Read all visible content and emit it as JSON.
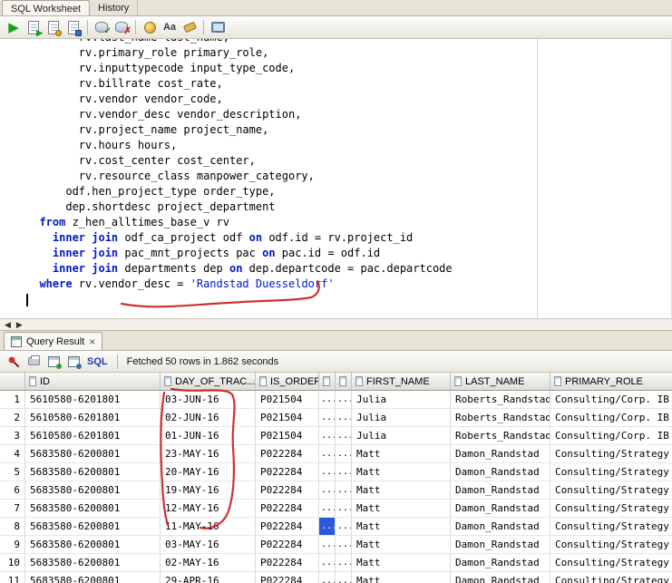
{
  "tabs": {
    "worksheet": "SQL Worksheet",
    "history": "History"
  },
  "icons": {
    "run_glyph": "▶",
    "scroll_left": "◀",
    "scroll_right": "▶",
    "close": "×",
    "commit_check": "✓",
    "rollback_x": "✗",
    "case_toggle": "Aa"
  },
  "worksheet_toolbar_icons": [
    "run-statement-icon",
    "run-script-icon",
    "autotrace-icon",
    "explain-plan-icon",
    "commit-icon",
    "rollback-icon",
    "sql-history-icon",
    "case-toggle-icon",
    "eraser-icon",
    "monitor-icon"
  ],
  "result_toolbar_icons": [
    "pin-icon",
    "printer-icon",
    "refresh-grid-icon",
    "fetch-grid-icon"
  ],
  "editor": {
    "lines": [
      [
        [
          "        rv.last_name last_name,",
          "p"
        ]
      ],
      [
        [
          "        rv.primary_role primary_role,",
          "p"
        ]
      ],
      [
        [
          "        rv.inputtypecode input_type_code,",
          "p"
        ]
      ],
      [
        [
          "        rv.billrate cost_rate,",
          "p"
        ]
      ],
      [
        [
          "        rv.vendor vendor_code,",
          "p"
        ]
      ],
      [
        [
          "        rv.vendor_desc vendor_description,",
          "p"
        ]
      ],
      [
        [
          "        rv.project_name project_name,",
          "p"
        ]
      ],
      [
        [
          "        rv.hours hours,",
          "p"
        ]
      ],
      [
        [
          "        rv.cost_center cost_center,",
          "p"
        ]
      ],
      [
        [
          "        rv.resource_class manpower_category,",
          "p"
        ]
      ],
      [
        [
          "      odf.hen_project_type order_type,",
          "p"
        ]
      ],
      [
        [
          "      dep.shortdesc project_department",
          "p"
        ]
      ],
      [
        [
          "  ",
          "p"
        ],
        [
          "from",
          "k"
        ],
        [
          " z_hen_alltimes_base_v rv",
          "p"
        ]
      ],
      [
        [
          "    ",
          "p"
        ],
        [
          "inner join",
          "k"
        ],
        [
          " odf_ca_project odf ",
          "p"
        ],
        [
          "on",
          "k"
        ],
        [
          " odf.id = rv.project_id",
          "p"
        ]
      ],
      [
        [
          "    ",
          "p"
        ],
        [
          "inner join",
          "k"
        ],
        [
          " pac_mnt_projects pac ",
          "p"
        ],
        [
          "on",
          "k"
        ],
        [
          " pac.id = odf.id",
          "p"
        ]
      ],
      [
        [
          "    ",
          "p"
        ],
        [
          "inner join",
          "k"
        ],
        [
          " departments dep ",
          "p"
        ],
        [
          "on",
          "k"
        ],
        [
          " dep.departcode = pac.departcode",
          "p"
        ]
      ],
      [
        [
          "  ",
          "p"
        ],
        [
          "where",
          "k"
        ],
        [
          " rv.vendor_desc = ",
          "p"
        ],
        [
          "'Randstad Duesseldorf'",
          "s"
        ]
      ]
    ]
  },
  "result_panel": {
    "tab_label": "Query Result",
    "sql_label": "SQL",
    "status": "Fetched 50 rows in 1.862 seconds"
  },
  "grid": {
    "columns": [
      {
        "label": ""
      },
      {
        "label": "ID"
      },
      {
        "label": "DAY_OF_TRAC..."
      },
      {
        "label": "IS_ORDER"
      },
      {
        "label": ""
      },
      {
        "label": ""
      },
      {
        "label": "FIRST_NAME"
      },
      {
        "label": "LAST_NAME"
      },
      {
        "label": "PRIMARY_ROLE"
      }
    ],
    "rows": [
      [
        "1",
        "5610580-6201801",
        "03-JUN-16",
        "P021504",
        "...",
        "...",
        "Julia",
        "Roberts_Randstad",
        "Consulting/Corp. IB"
      ],
      [
        "2",
        "5610580-6201801",
        "02-JUN-16",
        "P021504",
        "...",
        "...",
        "Julia",
        "Roberts_Randstad",
        "Consulting/Corp. IB"
      ],
      [
        "3",
        "5610580-6201801",
        "01-JUN-16",
        "P021504",
        "...",
        "...",
        "Julia",
        "Roberts_Randstad",
        "Consulting/Corp. IB"
      ],
      [
        "4",
        "5683580-6200801",
        "23-MAY-16",
        "P022284",
        "...",
        "...",
        "Matt",
        "Damon_Randstad",
        "Consulting/Strategy"
      ],
      [
        "5",
        "5683580-6200801",
        "20-MAY-16",
        "P022284",
        "...",
        "...",
        "Matt",
        "Damon_Randstad",
        "Consulting/Strategy"
      ],
      [
        "6",
        "5683580-6200801",
        "19-MAY-16",
        "P022284",
        "...",
        "...",
        "Matt",
        "Damon_Randstad",
        "Consulting/Strategy"
      ],
      [
        "7",
        "5683580-6200801",
        "12-MAY-16",
        "P022284",
        "...",
        "...",
        "Matt",
        "Damon_Randstad",
        "Consulting/Strategy"
      ],
      [
        "8",
        "5683580-6200801",
        "11-MAY-16",
        "P022284",
        "...",
        "...",
        "Matt",
        "Damon_Randstad",
        "Consulting/Strategy"
      ],
      [
        "9",
        "5683580-6200801",
        "03-MAY-16",
        "P022284",
        "...",
        "...",
        "Matt",
        "Damon_Randstad",
        "Consulting/Strategy"
      ],
      [
        "10",
        "5683580-6200801",
        "02-MAY-16",
        "P022284",
        "...",
        "...",
        "Matt",
        "Damon_Randstad",
        "Consulting/Strategy"
      ],
      [
        "11",
        "5683580-6200801",
        "29-APR-16",
        "P022284",
        "...",
        "...",
        "Matt",
        "Damon_Randstad",
        "Consulting/Strategy"
      ]
    ],
    "selected_cell": {
      "row": 7,
      "col": 4
    }
  },
  "colors": {
    "keyword": "#0018c8",
    "string": "#0018c8",
    "annotation_red": "#cc2020",
    "selection_blue": "#2a5bd7"
  }
}
